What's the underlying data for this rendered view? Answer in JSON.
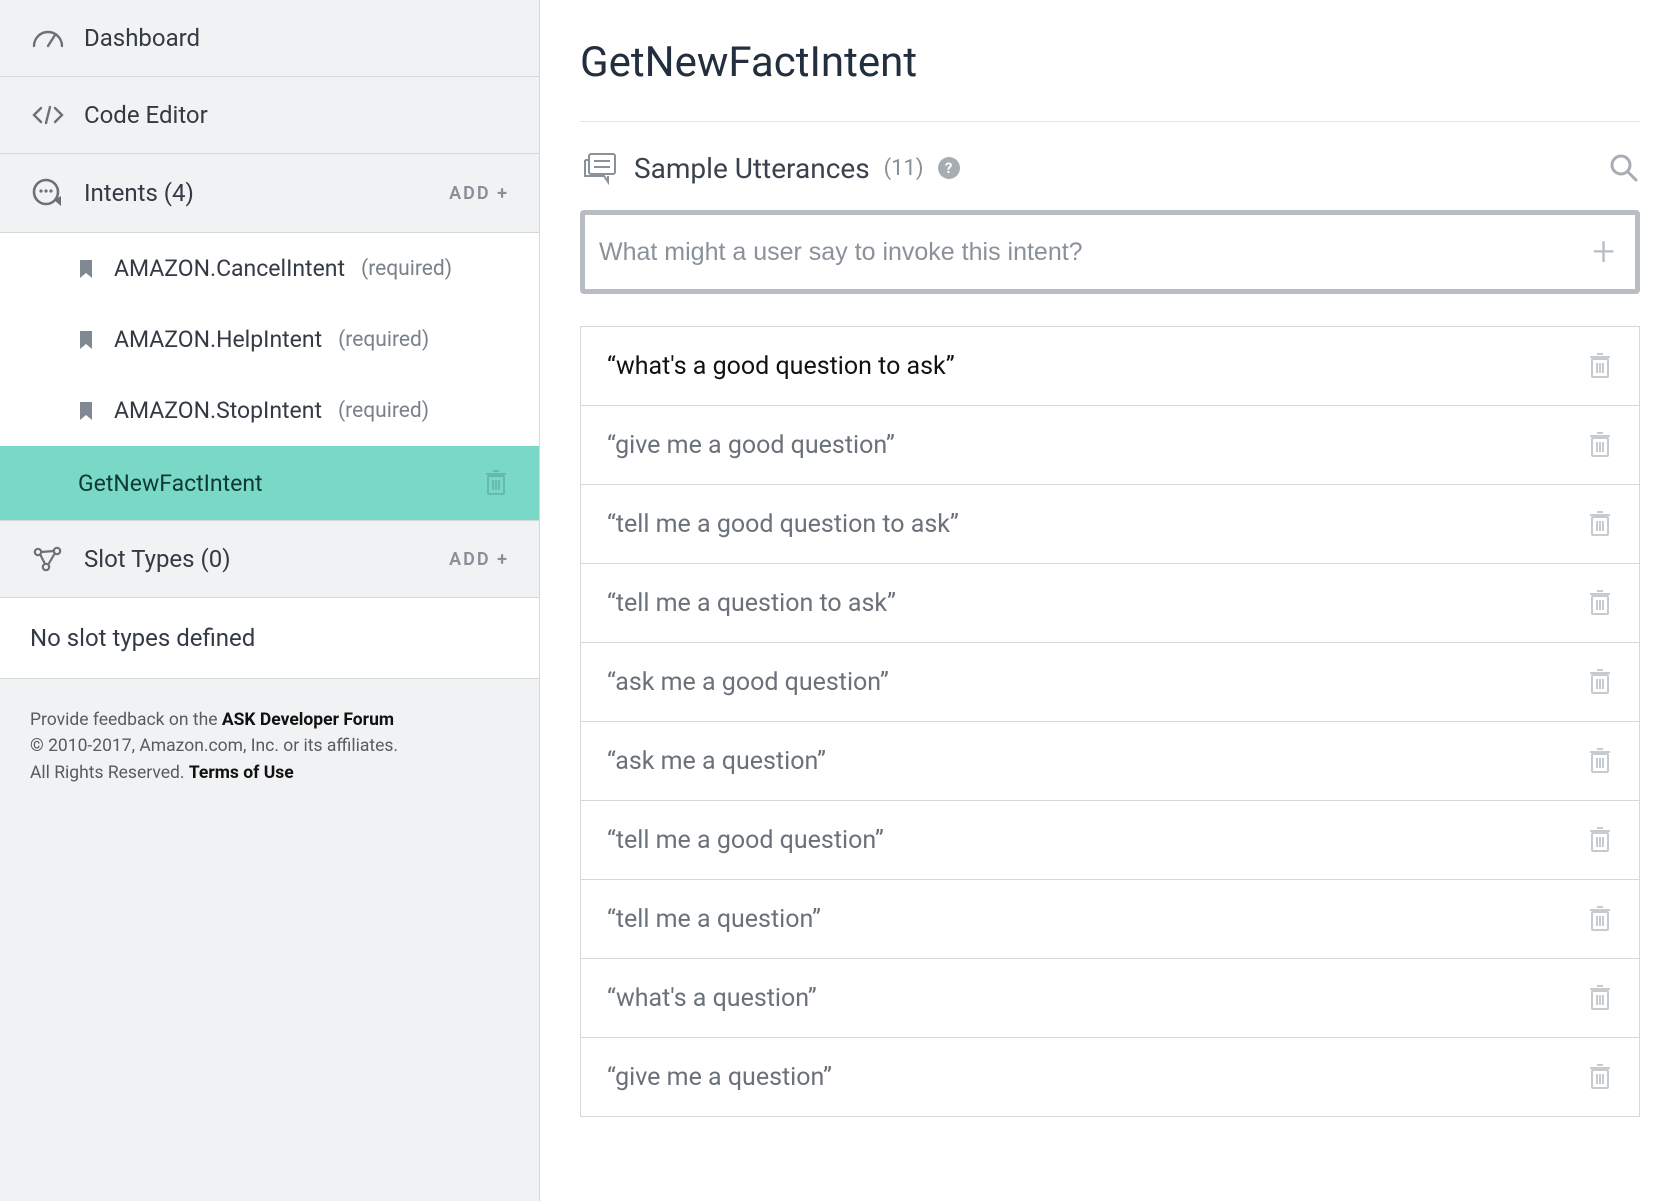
{
  "sidebar": {
    "dashboard_label": "Dashboard",
    "code_editor_label": "Code Editor",
    "intents_label": "Intents (4)",
    "intents_add": "ADD +",
    "intents": [
      {
        "name": "AMAZON.CancelIntent",
        "required_label": "(required)",
        "builtin": true
      },
      {
        "name": "AMAZON.HelpIntent",
        "required_label": "(required)",
        "builtin": true
      },
      {
        "name": "AMAZON.StopIntent",
        "required_label": "(required)",
        "builtin": true
      },
      {
        "name": "GetNewFactIntent",
        "required_label": "",
        "builtin": false,
        "selected": true
      }
    ],
    "slot_types_label": "Slot Types (0)",
    "slot_types_add": "ADD +",
    "slot_types_empty": "No slot types defined",
    "footer_feedback_pre": "Provide feedback on the ",
    "footer_feedback_link": "ASK Developer Forum",
    "footer_copyright": "© 2010-2017, Amazon.com, Inc. or its affiliates.",
    "footer_rights_pre": "All Rights Reserved. ",
    "footer_terms": "Terms of Use"
  },
  "main": {
    "title": "GetNewFactIntent",
    "utterances_heading": "Sample Utterances",
    "utterances_count": "(11)",
    "help_symbol": "?",
    "input_placeholder": "What might a user say to invoke this intent?",
    "plus_symbol": "+",
    "utterances": [
      {
        "text": "“what's a good question to ask”",
        "active": true
      },
      {
        "text": "“give me a good question”"
      },
      {
        "text": "“tell me a good question to ask”"
      },
      {
        "text": "“tell me a question to ask”"
      },
      {
        "text": "“ask me a good question”"
      },
      {
        "text": "“ask me a question”"
      },
      {
        "text": "“tell me a good question”"
      },
      {
        "text": "“tell me a question”"
      },
      {
        "text": "“what's a question”"
      },
      {
        "text": "“give me a question”"
      }
    ]
  }
}
